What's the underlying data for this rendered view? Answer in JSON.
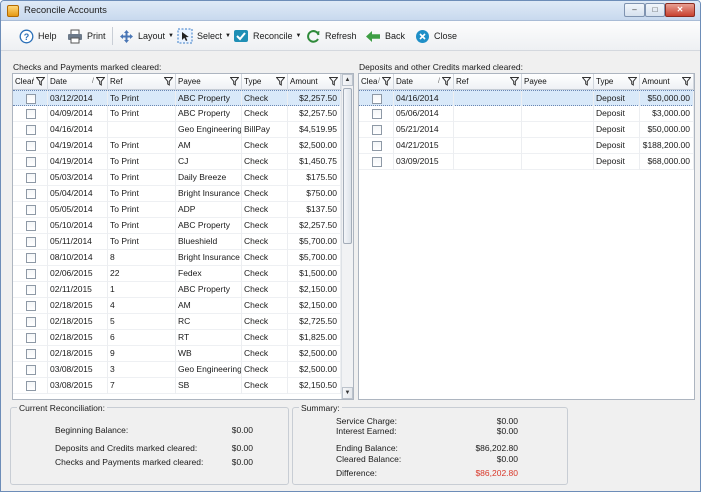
{
  "window": {
    "title": "Reconcile Accounts",
    "minimize": "–",
    "maximize": "□",
    "close": "✕"
  },
  "toolbar": {
    "help": "Help",
    "print": "Print",
    "layout": "Layout",
    "select": "Select",
    "reconcile": "Reconcile",
    "refresh": "Refresh",
    "back": "Back",
    "close": "Close"
  },
  "checks": {
    "label": "Checks and Payments marked cleared:",
    "columns": {
      "clear": "Clear",
      "date": "Date",
      "ref": "Ref",
      "payee": "Payee",
      "type": "Type",
      "amount": "Amount"
    },
    "rows": [
      {
        "date": "03/12/2014",
        "ref": "To Print",
        "payee": "ABC Property",
        "type": "Check",
        "amount": "$2,257.50"
      },
      {
        "date": "04/09/2014",
        "ref": "To Print",
        "payee": "ABC Property",
        "type": "Check",
        "amount": "$2,257.50"
      },
      {
        "date": "04/16/2014",
        "ref": "",
        "payee": "Geo Engineering",
        "type": "BillPay",
        "amount": "$4,519.95"
      },
      {
        "date": "04/19/2014",
        "ref": "To Print",
        "payee": "AM",
        "type": "Check",
        "amount": "$2,500.00"
      },
      {
        "date": "04/19/2014",
        "ref": "To Print",
        "payee": "CJ",
        "type": "Check",
        "amount": "$1,450.75"
      },
      {
        "date": "05/03/2014",
        "ref": "To Print",
        "payee": "Daily Breeze",
        "type": "Check",
        "amount": "$175.50"
      },
      {
        "date": "05/04/2014",
        "ref": "To Print",
        "payee": "Bright Insurance",
        "type": "Check",
        "amount": "$750.00"
      },
      {
        "date": "05/05/2014",
        "ref": "To Print",
        "payee": "ADP",
        "type": "Check",
        "amount": "$137.50"
      },
      {
        "date": "05/10/2014",
        "ref": "To Print",
        "payee": "ABC Property",
        "type": "Check",
        "amount": "$2,257.50"
      },
      {
        "date": "05/11/2014",
        "ref": "To Print",
        "payee": "Blueshield",
        "type": "Check",
        "amount": "$5,700.00"
      },
      {
        "date": "08/10/2014",
        "ref": "8",
        "payee": "Bright Insurance",
        "type": "Check",
        "amount": "$5,700.00"
      },
      {
        "date": "02/06/2015",
        "ref": "22",
        "payee": "Fedex",
        "type": "Check",
        "amount": "$1,500.00"
      },
      {
        "date": "02/11/2015",
        "ref": "1",
        "payee": "ABC Property",
        "type": "Check",
        "amount": "$2,150.00"
      },
      {
        "date": "02/18/2015",
        "ref": "4",
        "payee": "AM",
        "type": "Check",
        "amount": "$2,150.00"
      },
      {
        "date": "02/18/2015",
        "ref": "5",
        "payee": "RC",
        "type": "Check",
        "amount": "$2,725.50"
      },
      {
        "date": "02/18/2015",
        "ref": "6",
        "payee": "RT",
        "type": "Check",
        "amount": "$1,825.00"
      },
      {
        "date": "02/18/2015",
        "ref": "9",
        "payee": "WB",
        "type": "Check",
        "amount": "$2,500.00"
      },
      {
        "date": "03/08/2015",
        "ref": "3",
        "payee": "Geo Engineering",
        "type": "Check",
        "amount": "$2,500.00"
      },
      {
        "date": "03/08/2015",
        "ref": "7",
        "payee": "SB",
        "type": "Check",
        "amount": "$2,150.50"
      }
    ]
  },
  "deposits": {
    "label": "Deposits and other Credits marked cleared:",
    "columns": {
      "clear": "Clea",
      "date": "Date",
      "ref": "Ref",
      "payee": "Payee",
      "type": "Type",
      "amount": "Amount"
    },
    "rows": [
      {
        "date": "04/16/2014",
        "ref": "",
        "payee": "",
        "type": "Deposit",
        "amount": "$50,000.00"
      },
      {
        "date": "05/06/2014",
        "ref": "",
        "payee": "",
        "type": "Deposit",
        "amount": "$3,000.00"
      },
      {
        "date": "05/21/2014",
        "ref": "",
        "payee": "",
        "type": "Deposit",
        "amount": "$50,000.00"
      },
      {
        "date": "04/21/2015",
        "ref": "",
        "payee": "",
        "type": "Deposit",
        "amount": "$188,200.00"
      },
      {
        "date": "03/09/2015",
        "ref": "",
        "payee": "",
        "type": "Deposit",
        "amount": "$68,000.00"
      }
    ]
  },
  "current": {
    "legend": "Current Reconciliation:",
    "beginning_label": "Beginning Balance:",
    "beginning_value": "$0.00",
    "deposits_label": "Deposits and Credits marked cleared:",
    "deposits_value": "$0.00",
    "checks_label": "Checks and Payments marked cleared:",
    "checks_value": "$0.00"
  },
  "summary": {
    "legend": "Summary:",
    "service_label": "Service Charge:",
    "service_value": "$0.00",
    "interest_label": "Interest Earned:",
    "interest_value": "$0.00",
    "ending_label": "Ending Balance:",
    "ending_value": "$86,202.80",
    "cleared_label": "Cleared Balance:",
    "cleared_value": "$0.00",
    "difference_label": "Difference:",
    "difference_value": "$86,202.80",
    "difference_color": "#d9382a"
  }
}
